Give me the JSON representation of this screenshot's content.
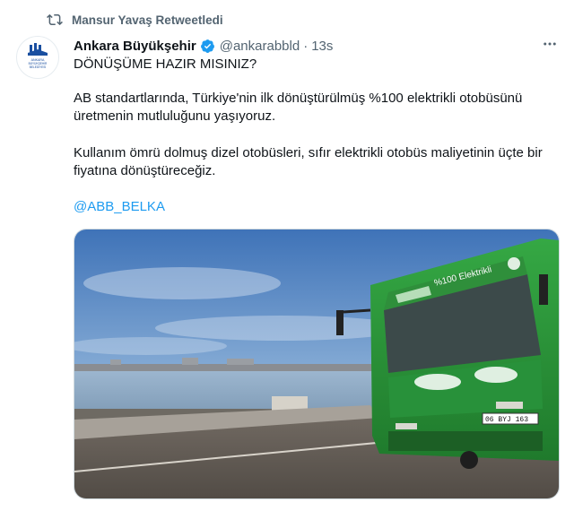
{
  "retweet": {
    "text": "Mansur Yavaş Retweetledi",
    "icon": "retweet-icon"
  },
  "author": {
    "name": "Ankara Büyükşehir",
    "handle": "@ankarabbld",
    "separator": "·",
    "time": "13s",
    "verified": true,
    "avatar_icon": "ankara-logo-icon",
    "avatar_logo_text": "ANKARA BÜYÜKŞEHİR BELEDİYESİ"
  },
  "tweet": {
    "line1": "DÖNÜŞÜME HAZIR MISINIZ?",
    "line2": "AB standartlarında, Türkiye'nin ilk dönüştürülmüş %100 elektrikli otobüsünü üretmenin mutluluğunu yaşıyoruz.",
    "line3": "Kullanım ömrü dolmuş dizel otobüsleri, sıfır elektrikli otobüs maliyetinin üçte bir fiyatına dönüştüreceğiz.",
    "mention": "@ABB_BELKA"
  },
  "media": {
    "bus_banner_text": "%100 Elektrikli",
    "plate": "06 BYJ 163"
  },
  "colors": {
    "link": "#1d9bf0",
    "secondary": "#536471",
    "bus": "#2e9b3a",
    "verified": "#1d9bf0"
  }
}
